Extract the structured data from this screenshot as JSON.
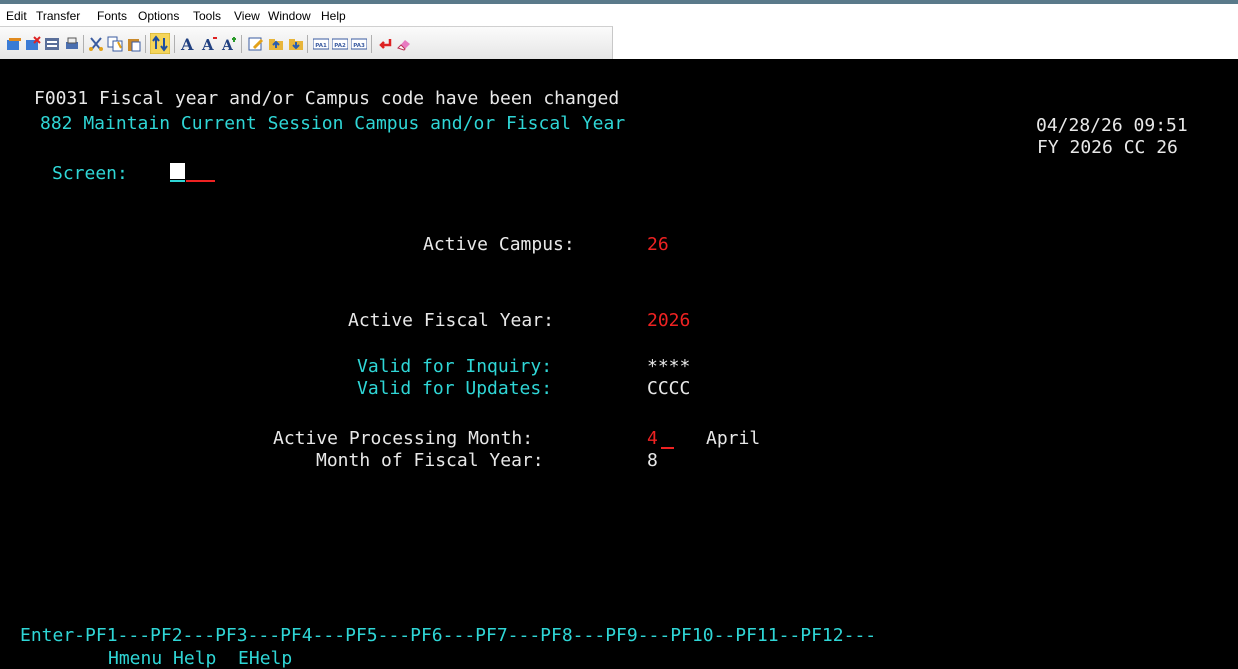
{
  "menu": [
    "Edit",
    "Transfer",
    "Fonts",
    "Options",
    "Tools",
    "View",
    "Window",
    "Help"
  ],
  "toolbar_icons": [
    "new-session-icon",
    "close-session-icon",
    "properties-icon",
    "print-icon",
    "cut-icon",
    "copy-icon",
    "paste-icon",
    "send-receive-icon",
    "font-a-icon",
    "font-a-larger-icon",
    "font-a-bold-icon",
    "edit-icon",
    "folder-up-icon",
    "folder-down-icon",
    "pa1-icon",
    "pa2-icon",
    "pa3-icon",
    "enter-icon",
    "erase-icon"
  ],
  "toolbar_labels": {
    "pa1": "PA1",
    "pa2": "PA2",
    "pa3": "PA3"
  },
  "screen": {
    "message": "F0031 Fiscal year and/or Campus code have been changed",
    "title": "882 Maintain Current Session Campus and/or Fiscal Year",
    "datetime": "04/28/26 09:51",
    "fy_cc": "FY 2026 CC 26",
    "screen_label": "Screen:",
    "active_campus_label": "Active Campus:",
    "active_campus_value": "26",
    "active_fy_label": "Active Fiscal Year:",
    "active_fy_value": "2026",
    "valid_inquiry_label": "Valid for Inquiry:",
    "valid_inquiry_value": "****",
    "valid_updates_label": "Valid for Updates:",
    "valid_updates_value": "CCCC",
    "active_month_label": "Active Processing Month:",
    "active_month_value": "4",
    "active_month_name": "April",
    "month_of_fy_label": "Month of Fiscal Year:",
    "month_of_fy_value": "8",
    "pf_keys": "Enter-PF1---PF2---PF3---PF4---PF5---PF6---PF7---PF8---PF9---PF10--PF11--PF12---",
    "pf_labels": "Hmenu Help  EHelp"
  }
}
